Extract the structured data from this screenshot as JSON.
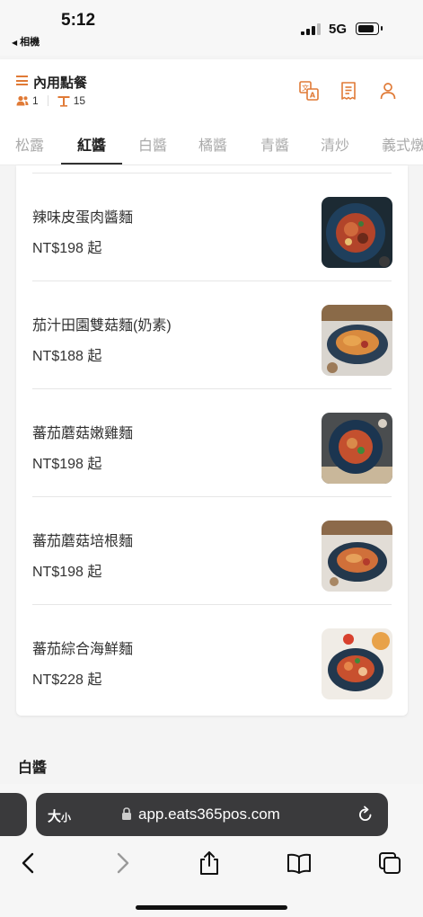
{
  "status": {
    "time": "5:12",
    "back_label": "相機",
    "network": "5G"
  },
  "header": {
    "title": "內用點餐",
    "guests": "1",
    "table": "15",
    "accent": "#e07a36"
  },
  "tabs": [
    "松露",
    "紅醬",
    "白醬",
    "橘醬",
    "青醬",
    "清炒",
    "義式燉"
  ],
  "active_tab": "紅醬",
  "menu_items": [
    {
      "name": "辣味皮蛋肉醬麵",
      "price": "NT$198 起"
    },
    {
      "name": "茄汁田園雙菇麵(奶素)",
      "price": "NT$188 起"
    },
    {
      "name": "蕃茄蘑菇嫩雞麵",
      "price": "NT$198 起"
    },
    {
      "name": "蕃茄蘑菇培根麵",
      "price": "NT$198 起"
    },
    {
      "name": "蕃茄綜合海鮮麵",
      "price": "NT$228 起"
    }
  ],
  "next_section": "白醬",
  "browser": {
    "text_size_big": "大",
    "text_size_small": "小",
    "url": "app.eats365pos.com"
  }
}
